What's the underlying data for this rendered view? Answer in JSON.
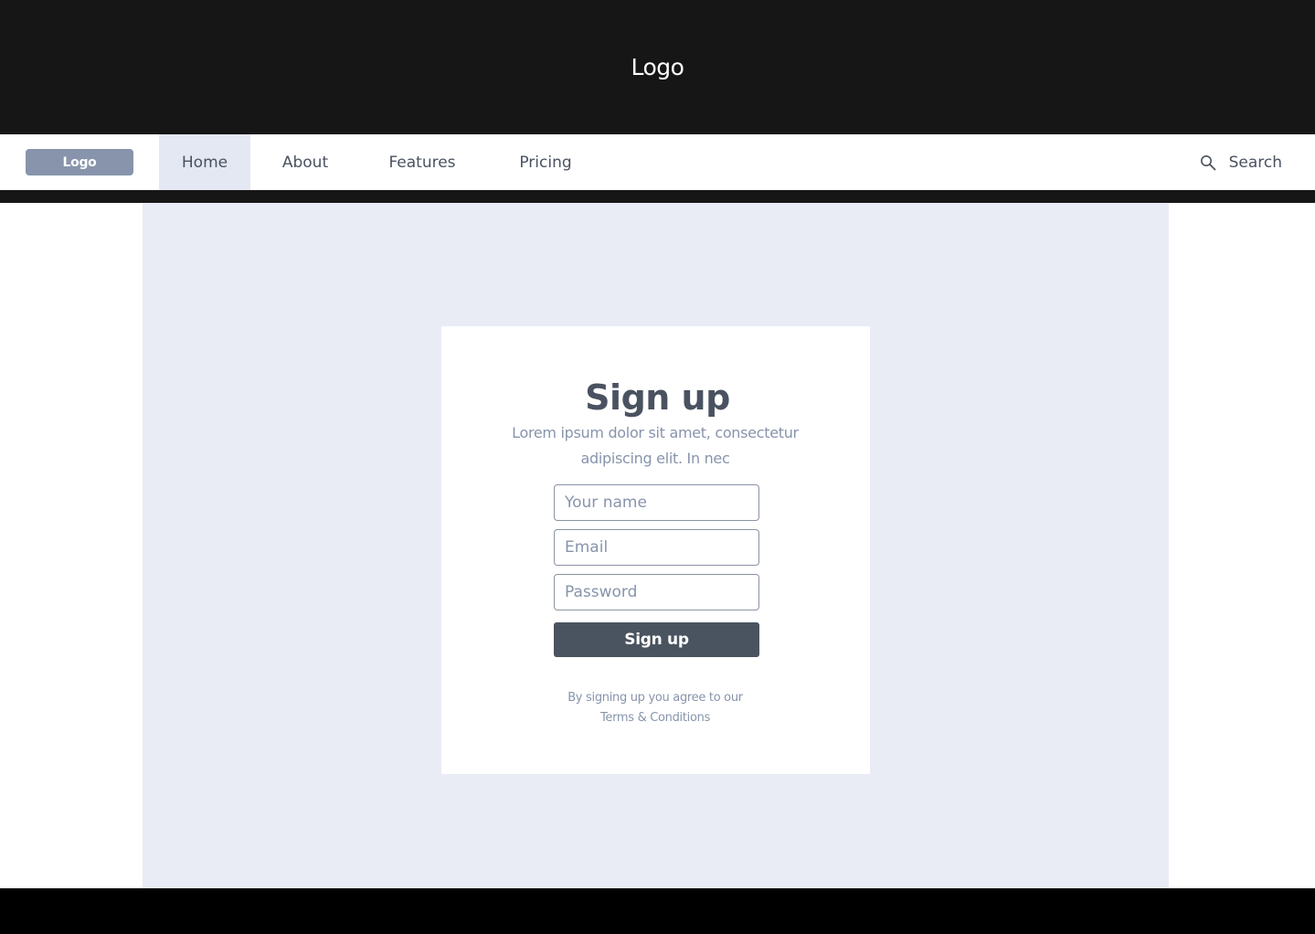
{
  "banner": {
    "logo_text": "Logo"
  },
  "nav": {
    "logo_label": "Logo",
    "items": [
      {
        "label": "Home",
        "active": true
      },
      {
        "label": "About",
        "active": false
      },
      {
        "label": "Features",
        "active": false
      },
      {
        "label": "Pricing",
        "active": false
      }
    ],
    "search_label": "Search",
    "search_icon": "search-icon"
  },
  "signup": {
    "title": "Sign up",
    "description": "Lorem ipsum dolor sit amet, consectetur adipiscing elit. In nec",
    "name_placeholder": "Your name",
    "email_placeholder": "Email",
    "password_placeholder": "Password",
    "button_label": "Sign up",
    "terms_prefix": "By signing up you agree to our",
    "terms_link": "Terms & Conditions"
  },
  "colors": {
    "banner_bg": "#161616",
    "nav_logo_bg": "#8794ab",
    "active_nav_bg": "#e4e8f2",
    "content_bg": "#e9ecf5",
    "button_bg": "#4a5460",
    "text_primary": "#4a5261",
    "text_muted": "#8794ab"
  }
}
